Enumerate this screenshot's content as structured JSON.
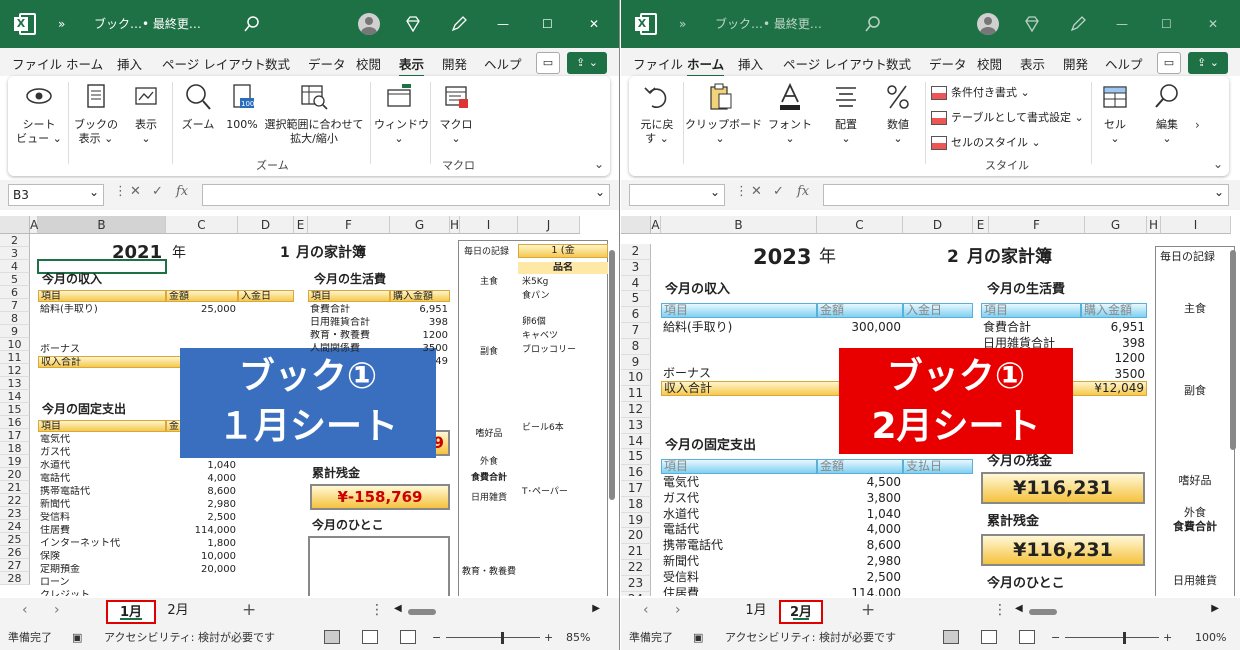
{
  "colors": {
    "title_bar": "#1e7145",
    "accent_green": "#1e7145",
    "highlight_red": "#e00000",
    "overlay_blue": "#3a6fbf",
    "overlay_red": "#e80000",
    "header_yellow": "#f6c94d",
    "header_blue": "#7fd0f2"
  },
  "title_bar": {
    "book_name": "ブック…",
    "save_status": "• 最終更…",
    "chevron": "»",
    "min": "—",
    "max": "☐",
    "close": "✕"
  },
  "menu_tabs": [
    "ファイル",
    "ホーム",
    "挿入",
    "ページ レイアウト",
    "数式",
    "データ",
    "校閲",
    "表示",
    "開発",
    "ヘルプ"
  ],
  "left": {
    "active_menu": "表示",
    "ribbon": {
      "buttons": [
        {
          "label": "シート\nビュー ⌄",
          "icon": "eye-icon"
        },
        {
          "label": "ブックの\n表示 ⌄",
          "icon": "book-view-icon"
        },
        {
          "label": "表示\n⌄",
          "icon": "show-icon"
        },
        {
          "label": "ズーム",
          "icon": "zoom-icon"
        },
        {
          "label": "100%",
          "icon": "zoom-100-icon"
        },
        {
          "label": "選択範囲に合わせて\n拡大/縮小",
          "icon": "zoom-selection-icon"
        },
        {
          "label": "ウィンドウ\n⌄",
          "icon": "window-icon"
        },
        {
          "label": "マクロ\n⌄",
          "icon": "macro-icon"
        }
      ],
      "group_labels": [
        "ズーム",
        "マクロ"
      ]
    },
    "name_box": "B3",
    "columns": [
      "A",
      "B",
      "C",
      "D",
      "E",
      "F",
      "G",
      "H",
      "I",
      "J"
    ],
    "rows": [
      "2",
      "3",
      "4",
      "5",
      "6",
      "7",
      "8",
      "9",
      "10",
      "11",
      "12",
      "13",
      "14",
      "15",
      "16",
      "17",
      "18",
      "19",
      "20",
      "21",
      "22",
      "23",
      "24",
      "25",
      "26",
      "27",
      "28"
    ],
    "title_year": "2021",
    "year_unit": "年",
    "title_month": "1",
    "month_title": "月の家計簿",
    "income": {
      "title": "今月の収入",
      "headers": [
        "項目",
        "金額",
        "入金日"
      ],
      "salary": "給料(手取り)",
      "salary_amount": "25,000",
      "bonus": "ボーナス",
      "total": "収入合計"
    },
    "living": {
      "title": "今月の生活費",
      "headers": [
        "項目",
        "購入金額"
      ],
      "rows": [
        {
          "name": "食費合計",
          "value": "6,951"
        },
        {
          "name": "日用雑貨合計",
          "value": "398"
        },
        {
          "name": "教育・教養費",
          "value": "1200"
        },
        {
          "name": "人間関係費",
          "value": "3500"
        }
      ],
      "total_partial": "49"
    },
    "fixed": {
      "title": "今月の固定支出",
      "header": "項目",
      "header2": "金",
      "rows": [
        {
          "name": "電気代",
          "value": ""
        },
        {
          "name": "ガス代",
          "value": ""
        },
        {
          "name": "水道代",
          "value": "1,040"
        },
        {
          "name": "電話代",
          "value": "4,000"
        },
        {
          "name": "携帯電話代",
          "value": "8,600"
        },
        {
          "name": "新聞代",
          "value": "2,980"
        },
        {
          "name": "受信料",
          "value": "2,500"
        },
        {
          "name": "住居費",
          "value": "114,000"
        },
        {
          "name": "インターネット代",
          "value": "1,800"
        },
        {
          "name": "保険",
          "value": "10,000"
        },
        {
          "name": "定期預金",
          "value": "20,000"
        },
        {
          "name": "ローン",
          "value": ""
        },
        {
          "name": "クレジット",
          "value": ""
        }
      ]
    },
    "balance_partial": "9",
    "cumulative": {
      "title": "累計残金",
      "value": "¥-158,769"
    },
    "comment_title": "今月のひとこ",
    "record": {
      "title": "毎日の記録",
      "partial": "1 (金",
      "item_header": "品名",
      "categories": [
        "主食",
        "副食",
        "嗜好品",
        "外食",
        "食費合計",
        "日用雑貨",
        "教育・教養費"
      ],
      "items": [
        "米5Kg",
        "食パン",
        "卵6個",
        "キャベツ",
        "ブロッコリー",
        "ビール6本",
        "T･ペーパー"
      ]
    },
    "overlay": {
      "line1": "ブック①",
      "line2": "１月シート"
    },
    "sheets": [
      "1月",
      "2月"
    ],
    "active_sheet": "1月",
    "status": {
      "ready": "準備完了",
      "accessibility": "アクセシビリティ: 検討が必要です",
      "zoom": "85%",
      "zoom_level": 0.58
    }
  },
  "right": {
    "active_menu": "ホーム",
    "ribbon": {
      "buttons": [
        {
          "label": "元に戻\nす ⌄",
          "icon": "undo-icon"
        },
        {
          "label": "クリップボード\n⌄",
          "icon": "clipboard-icon"
        },
        {
          "label": "フォント\n⌄",
          "icon": "font-icon"
        },
        {
          "label": "配置\n⌄",
          "icon": "align-icon"
        },
        {
          "label": "数値\n⌄",
          "icon": "percent-icon"
        },
        {
          "label": "セル\n⌄",
          "icon": "cells-icon"
        },
        {
          "label": "編集\n⌄",
          "icon": "search-icon"
        }
      ],
      "style_items": [
        "条件付き書式 ⌄",
        "テーブルとして書式設定 ⌄",
        "セルのスタイル ⌄"
      ],
      "group_label": "スタイル"
    },
    "name_box": "",
    "columns": [
      "A",
      "B",
      "C",
      "D",
      "E",
      "F",
      "G",
      "H",
      "I"
    ],
    "rows": [
      "2",
      "3",
      "4",
      "5",
      "6",
      "7",
      "8",
      "9",
      "10",
      "11",
      "12",
      "13",
      "14",
      "15",
      "16",
      "17",
      "18",
      "19",
      "20",
      "21",
      "22",
      "23",
      "24"
    ],
    "title_year": "2023",
    "year_unit": "年",
    "title_month": "2",
    "month_title": "月の家計簿",
    "income": {
      "title": "今月の収入",
      "headers": [
        "項目",
        "金額",
        "入金日"
      ],
      "salary": "給料(手取り)",
      "salary_amount": "300,000",
      "bonus": "ボーナス",
      "total": "収入合計"
    },
    "living": {
      "title": "今月の生活費",
      "headers": [
        "項目",
        "購入金額"
      ],
      "rows": [
        {
          "name": "食費合計",
          "value": "6,951"
        },
        {
          "name": "日用雑貨合計",
          "value": "398"
        },
        {
          "name": "",
          "value": "1200"
        },
        {
          "name": "",
          "value": "3500"
        }
      ],
      "total": "¥12,049"
    },
    "fixed": {
      "title": "今月の固定支出",
      "headers": [
        "項目",
        "金額",
        "支払日"
      ],
      "rows": [
        {
          "name": "電気代",
          "value": "4,500"
        },
        {
          "name": "ガス代",
          "value": "3,800"
        },
        {
          "name": "水道代",
          "value": "1,040"
        },
        {
          "name": "電話代",
          "value": "4,000"
        },
        {
          "name": "携帯電話代",
          "value": "8,600"
        },
        {
          "name": "新聞代",
          "value": "2,980"
        },
        {
          "name": "受信料",
          "value": "2,500"
        },
        {
          "name": "住居費",
          "value": "114,000"
        }
      ]
    },
    "balance": {
      "title": "今月の残金",
      "value": "¥116,231"
    },
    "cumulative": {
      "title": "累計残金",
      "value": "¥116,231"
    },
    "comment_title": "今月のひとこ",
    "record": {
      "title": "毎日の記録",
      "categories": [
        "主食",
        "副食",
        "嗜好品",
        "外食",
        "食費合計",
        "日用雑貨"
      ]
    },
    "overlay": {
      "line1": "ブック①",
      "line2": "2月シート"
    },
    "sheets": [
      "1月",
      "2月"
    ],
    "active_sheet": "2月",
    "status": {
      "ready": "準備完了",
      "accessibility": "アクセシビリティ: 検討が必要です",
      "zoom": "100%",
      "zoom_level": 0.62
    }
  }
}
